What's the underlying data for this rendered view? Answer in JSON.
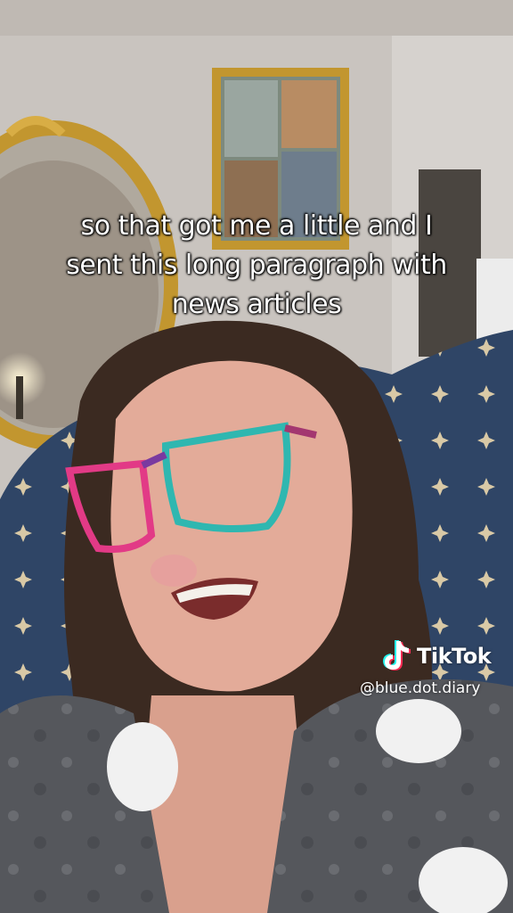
{
  "caption": {
    "line1": "so that got me a little and I",
    "line2": "sent this long paragraph with",
    "line3": "news articles"
  },
  "watermark": {
    "brand": "TikTok",
    "handle": "@blue.dot.diary",
    "icon": "tiktok-logo-icon"
  },
  "colors": {
    "caption_text": "#ffffff",
    "chair_fabric": "#2f4566",
    "frame_gold": "#c2962f",
    "glasses_pink": "#e23a86",
    "glasses_teal": "#2fb7b0"
  }
}
